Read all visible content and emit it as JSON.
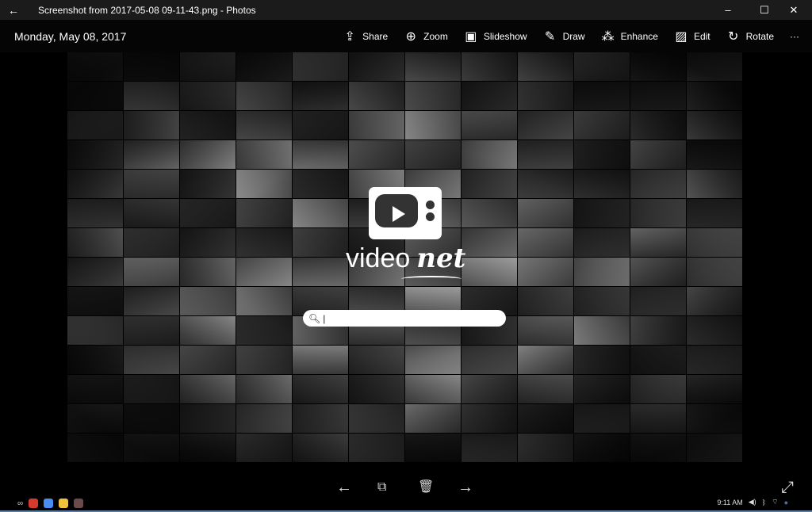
{
  "window": {
    "title": "Screenshot from 2017-05-08 09-11-43.png - Photos",
    "minimize": "–",
    "maximize": "☐",
    "close": "✕",
    "back": "←"
  },
  "toolbar": {
    "date": "Monday, May 08, 2017",
    "tools": [
      {
        "label": "Share",
        "icon": "share-icon",
        "glyph": "⇪"
      },
      {
        "label": "Zoom",
        "icon": "zoom-icon",
        "glyph": "⊕"
      },
      {
        "label": "Slideshow",
        "icon": "slideshow-icon",
        "glyph": "▣"
      },
      {
        "label": "Draw",
        "icon": "draw-icon",
        "glyph": "✎"
      },
      {
        "label": "Enhance",
        "icon": "enhance-icon",
        "glyph": "⁂"
      },
      {
        "label": "Edit",
        "icon": "edit-icon",
        "glyph": "▨"
      },
      {
        "label": "Rotate",
        "icon": "rotate-icon",
        "glyph": "↻"
      }
    ],
    "more": "···"
  },
  "image": {
    "brand_light": "video",
    "brand_bold": "net",
    "search_value": "|"
  },
  "nav": {
    "prev": "←",
    "tag": "⧉",
    "delete": "🗑",
    "next": "→",
    "fullscreen": "⤢"
  },
  "taskbar": {
    "time": "9:11 AM",
    "launcher": "∞",
    "apps": [
      {
        "name": "chrome",
        "color": "#d33b2c"
      },
      {
        "name": "docs",
        "color": "#4a8df0"
      },
      {
        "name": "files",
        "color": "#f2c23c"
      },
      {
        "name": "app",
        "color": "#6a4a4a"
      }
    ]
  }
}
